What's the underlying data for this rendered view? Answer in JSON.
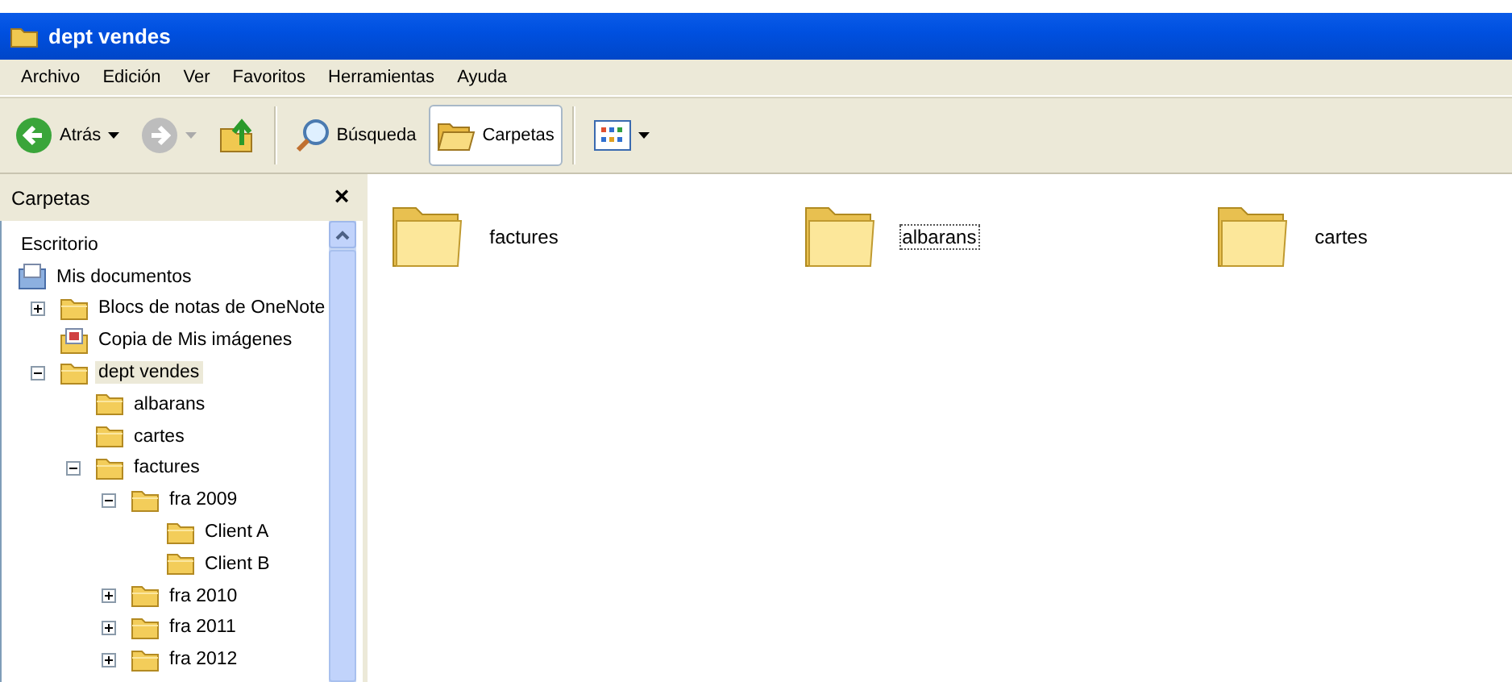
{
  "window": {
    "title": "dept vendes"
  },
  "menu": [
    "Archivo",
    "Edición",
    "Ver",
    "Favoritos",
    "Herramientas",
    "Ayuda"
  ],
  "toolbar": [
    {
      "kind": "back",
      "label": "Atrás",
      "disabled": false
    },
    {
      "kind": "forward",
      "disabled": true
    },
    {
      "kind": "up"
    },
    {
      "kind": "separator"
    },
    {
      "kind": "search",
      "label": "Búsqueda",
      "selected": false
    },
    {
      "kind": "folders",
      "label": "Carpetas",
      "selected": true
    },
    {
      "kind": "separator"
    },
    {
      "kind": "views"
    }
  ],
  "sidebar": {
    "title": "Carpetas",
    "close": "×",
    "tree": [
      {
        "label": "Escritorio",
        "selected": false
      },
      {
        "label": "Mis documentos",
        "kind": "documents",
        "selected": false,
        "children": [
          {
            "label": "Blocs de notas de OneNote",
            "kind": "folder",
            "expanded": false,
            "selected": false
          },
          {
            "label": "Copia de Mis imágenes",
            "kind": "pictures",
            "selected": false
          },
          {
            "label": "dept vendes",
            "kind": "folder",
            "expanded": true,
            "selected": true,
            "children": [
              {
                "label": "albarans",
                "kind": "folder",
                "selected": false
              },
              {
                "label": "cartes",
                "kind": "folder",
                "selected": false
              },
              {
                "label": "factures",
                "kind": "folder",
                "expanded": true,
                "selected": false,
                "children": [
                  {
                    "label": "fra 2009",
                    "kind": "folder",
                    "expanded": true,
                    "selected": false,
                    "children": [
                      {
                        "label": "Client A",
                        "kind": "folder",
                        "selected": false
                      },
                      {
                        "label": "Client B",
                        "kind": "folder",
                        "selected": false
                      }
                    ]
                  },
                  {
                    "label": "fra 2010",
                    "kind": "folder",
                    "expanded": false,
                    "selected": false
                  },
                  {
                    "label": "fra 2011",
                    "kind": "folder",
                    "expanded": false,
                    "selected": false
                  },
                  {
                    "label": "fra 2012",
                    "kind": "folder",
                    "expanded": false,
                    "selected": false
                  }
                ]
              }
            ]
          }
        ]
      }
    ]
  },
  "files": [
    {
      "name": "factures",
      "focused": false
    },
    {
      "name": "albarans",
      "focused": true
    },
    {
      "name": "cartes",
      "focused": false
    }
  ]
}
